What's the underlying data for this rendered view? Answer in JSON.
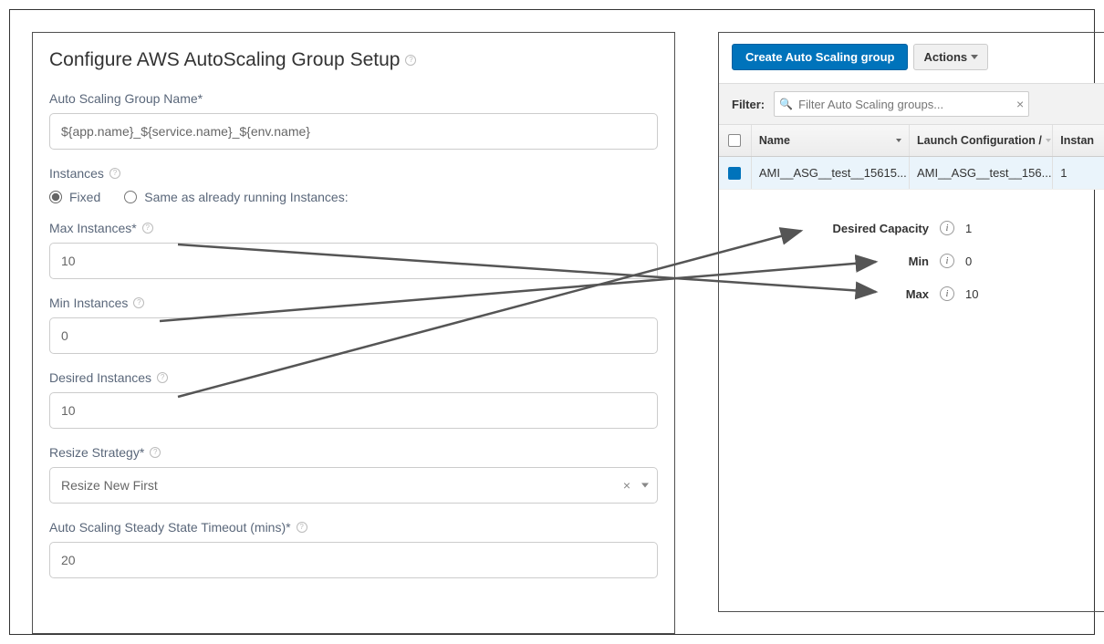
{
  "title": "Configure AWS AutoScaling Group Setup",
  "form": {
    "group_name_label": "Auto Scaling Group Name*",
    "group_name_value": "${app.name}_${service.name}_${env.name}",
    "instances_label": "Instances",
    "radio_fixed": "Fixed",
    "radio_same": "Same as already running Instances:",
    "max_label": "Max Instances*",
    "max_value": "10",
    "min_label": "Min Instances",
    "min_value": "0",
    "desired_label": "Desired Instances",
    "desired_value": "10",
    "resize_label": "Resize Strategy*",
    "resize_value": "Resize New First",
    "timeout_label": "Auto Scaling Steady State Timeout (mins)*",
    "timeout_value": "20"
  },
  "aws": {
    "create_btn": "Create Auto Scaling group",
    "actions_btn": "Actions",
    "filter_label": "Filter:",
    "filter_placeholder": "Filter Auto Scaling groups...",
    "columns": {
      "name": "Name",
      "lc": "Launch Configuration /",
      "inst": "Instan"
    },
    "row": {
      "name": "AMI__ASG__test__15615...",
      "lc": "AMI__ASG__test__156...",
      "inst": "1"
    },
    "details": {
      "desired_label": "Desired Capacity",
      "desired_val": "1",
      "min_label": "Min",
      "min_val": "0",
      "max_label": "Max",
      "max_val": "10"
    }
  }
}
